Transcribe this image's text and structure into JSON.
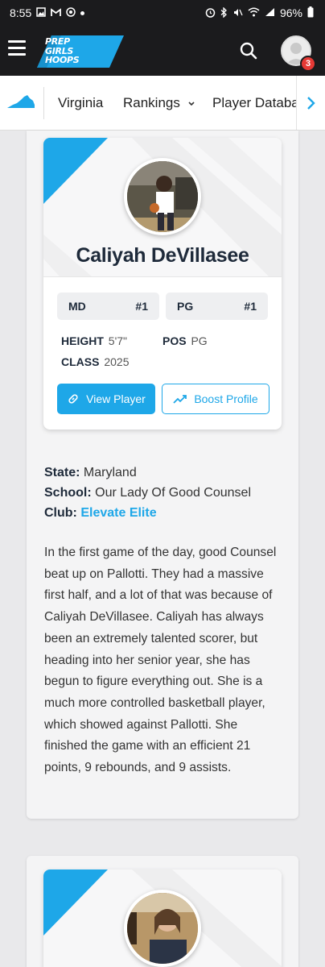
{
  "status_bar": {
    "time": "8:55",
    "battery": "96%"
  },
  "header": {
    "logo_lines": [
      "PREP",
      "GIRLS",
      "HOOPS"
    ],
    "notification_count": "3"
  },
  "nav": {
    "items": [
      {
        "label": "Virginia"
      },
      {
        "label": "Rankings"
      },
      {
        "label": "Player Database"
      }
    ]
  },
  "player": {
    "name": "Caliyah DeVillasee",
    "rankings": [
      {
        "scope": "MD",
        "rank": "#1"
      },
      {
        "scope": "PG",
        "rank": "#1"
      }
    ],
    "height_label": "HEIGHT",
    "height": "5'7\"",
    "pos_label": "POS",
    "pos": "PG",
    "class_label": "CLASS",
    "class": "2025",
    "view_button": "View Player",
    "boost_button": "Boost Profile"
  },
  "details": {
    "state_label": "State:",
    "state": "Maryland",
    "school_label": "School:",
    "school": "Our Lady Of Good Counsel",
    "club_label": "Club:",
    "club": "Elevate Elite"
  },
  "article_text": "In the first game of the day, good Counsel beat up on Pallotti. They had a massive first half, and a lot of that was because of Caliyah DeVillasee. Caliyah has always been an extremely talented scorer, but heading into her senior year, she has begun to figure everything out. She is a much more controlled basketball player, which showed against Pallotti. She finished the game with an efficient 21 points, 9 rebounds, and 9 assists.",
  "colors": {
    "accent": "#1ea7e8",
    "header_bg": "#1b1b1d",
    "badge": "#e53935"
  }
}
